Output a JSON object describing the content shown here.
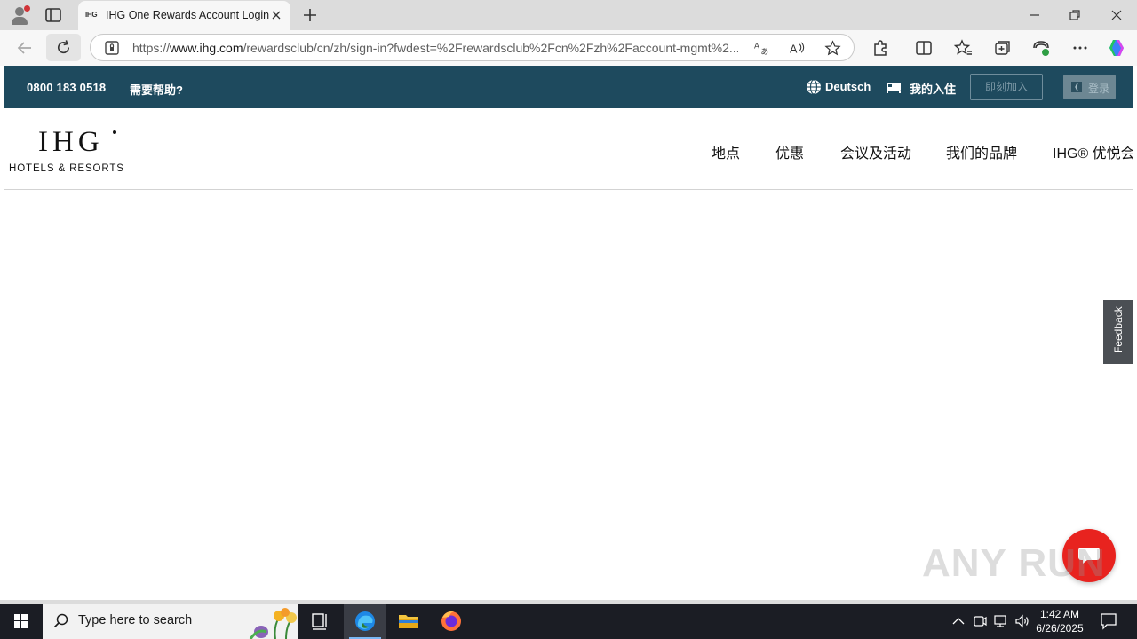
{
  "browser": {
    "tab": {
      "favicon_text": "IHG",
      "title": "IHG One Rewards Account Login"
    },
    "address_bar": {
      "url_prefix": "https://",
      "url_host": "www.ihg.com",
      "url_rest": "/rewardsclub/cn/zh/sign-in?fwdest=%2Frewardsclub%2Fcn%2Fzh%2Faccount-mgmt%2..."
    }
  },
  "site": {
    "topbar": {
      "phone": "0800 183 0518",
      "help": "需要帮助?",
      "language": "Deutsch",
      "my_stays": "我的入住",
      "join_now": "即刻加入",
      "sign_in": "登录"
    },
    "logo": {
      "main": "IHG",
      "sub": "HOTELS & RESORTS"
    },
    "nav": [
      {
        "label": "地点"
      },
      {
        "label": "优惠"
      },
      {
        "label": "会议及活动"
      },
      {
        "label": "我们的品牌"
      },
      {
        "label": "IHG® 优悦会"
      }
    ],
    "feedback": "Feedback",
    "watermark": "ANY RUN"
  },
  "taskbar": {
    "search_placeholder": "Type here to search",
    "time": "1:42 AM",
    "date": "6/26/2025"
  },
  "colors": {
    "topbar_bg": "#1e4a5e",
    "chat_button": "#e8231f",
    "feedback_tab": "#4b4f54",
    "taskbar_bg": "#1b1d24"
  }
}
